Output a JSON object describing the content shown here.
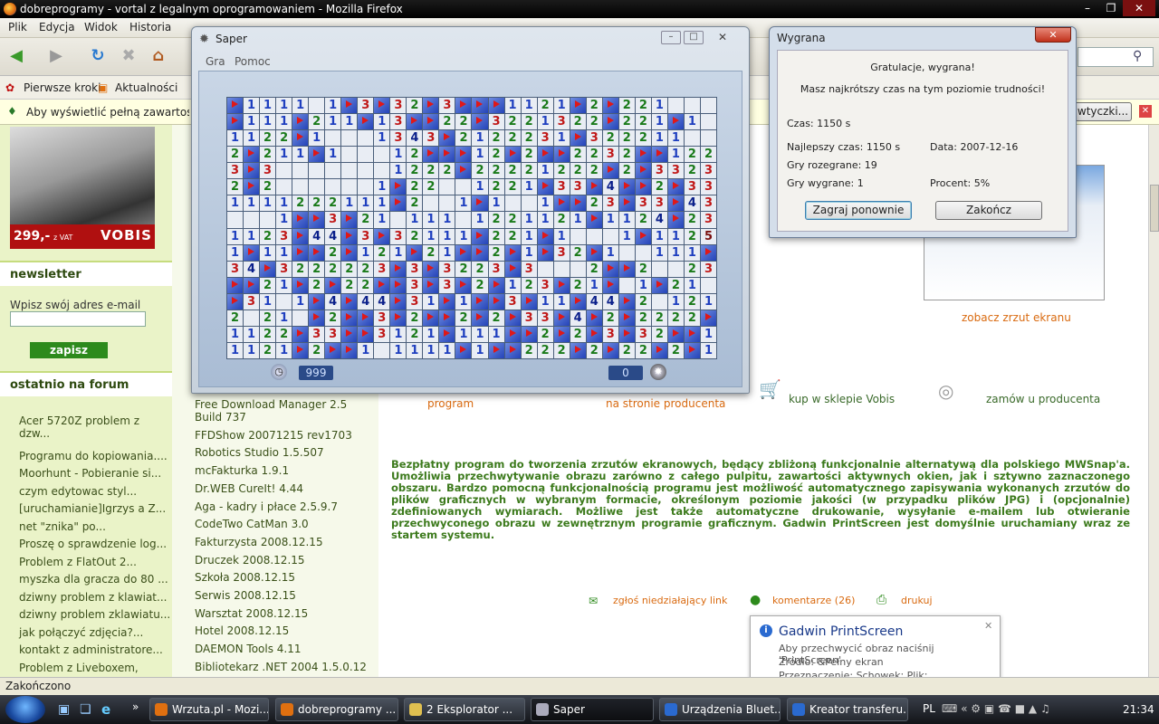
{
  "firefox": {
    "title": "dobreprogramy - vortal z legalnym oprogramowaniem - Mozilla Firefox",
    "menu": [
      "Plik",
      "Edycja",
      "Widok",
      "Historia",
      "Zakładki",
      "Narzędzia",
      "Pomoc"
    ],
    "bookmarks": [
      "Pierwsze kroki",
      "Aktualności"
    ],
    "info_bar": "Aby wyświetlić pełną zawartość tej strony, należy zainstalować dodatkowe wtyczki.",
    "info_button": "wtyczki...",
    "status": "Zakończono"
  },
  "page": {
    "ad_price": "299,-",
    "ad_vat": "z VAT",
    "ad_brand": "VOBIS",
    "newsletter_heading": "newsletter",
    "newsletter_label": "Wpisz swój adres e-mail",
    "newsletter_submit": "zapisz",
    "forum_heading": "ostatnio na forum",
    "forum_items": [
      "Acer 5720Z problem z dzw...",
      "Programu do kopiowania....",
      "Moorhunt - Pobieranie si...",
      "czym edytowac styl...",
      "[uruchamianie]Igrzys a Z...",
      "net \"znika\" po...",
      "Proszę o sprawdzenie log...",
      "Problem z FlatOut 2...",
      "myszka dla gracza do 80 ...",
      "dziwny problem z klawiat...",
      "dziwny problem zklawiatu...",
      "jak połączyć zdjęcia?...",
      "kontakt z administratore...",
      "Problem z Liveboxem,"
    ],
    "downloads": [
      "Free Download Manager 2.5 Build 737",
      "FFDShow 20071215 rev1703",
      "Robotics Studio 1.5.507",
      "mcFakturka 1.9.1",
      "Dr.WEB CureIt! 4.44",
      "Aga - kadry i płace 2.5.9.7",
      "CodeTwo CatMan 3.0",
      "Fakturzysta 2008.12.15",
      "Druczek 2008.12.15",
      "Szkoła 2008.12.15",
      "Serwis 2008.12.15",
      "Warsztat 2008.12.15",
      "Hotel 2008.12.15",
      "DAEMON Tools 4.11",
      "Bibliotekarz .NET 2004 1.5.0.12"
    ],
    "actions": {
      "download": "program",
      "producer_link": "na stronie producenta",
      "shop": "kup w sklepie Vobis",
      "order": "zamów u producenta"
    },
    "screenshot_link": "zobacz zrzut ekranu",
    "description": "Bezpłatny program do tworzenia zrzutów ekranowych, będący zbliżoną funkcjonalnie alternatywą dla polskiego MWSnap'a. Umożliwia przechwytywanie obrazu zarówno z całego pulpitu, zawartości aktywnych okien, jak i sztywno zaznaczonego obszaru. Bardzo pomocną funkcjonalnością programu jest możliwość automatycznego zapisywania wykonanych zrzutów do plików graficznych w wybranym formacie, określonym poziomie jakości (w przypadku plików JPG) i (opcjonalnie) zdefiniowanych wymiarach. Możliwe jest także automatyczne drukowanie, wysyłanie e-mailem lub otwieranie przechwyconego obrazu w zewnętrznym programie graficznym. Gadwin PrintScreen jest domyślnie uruchamiany wraz ze startem systemu.",
    "links": {
      "report": "zgłoś niedziałający link",
      "comments": "komentarze (26)",
      "print": "drukuj"
    }
  },
  "saper": {
    "title": "Saper",
    "menu": [
      "Gra",
      "Pomoc"
    ],
    "timer": "999",
    "mines_left": "0",
    "rows": [
      "F1111.1F3F32F3FFF1121F2F221....",
      "F111F211F13FF22F3221322F221F1..",
      "1122F1...1343F2122231F322211...",
      "2F211F1...12FFF12F2FF2232FF12221",
      "3F3.......1222F22221222F2F3323343F1",
      "2F2......1F22..1221F33F4FF2F33F21",
      "1111222111F2..1F1..1FF23F33F43321",
      "...1FF3F21.111.1221121F1124F23F",
      "1123F44F3F32111F221F1...1F1125F5",
      "1F11FF2F121F21FF2F1F32F1..111FF2F4F",
      "34F3222223F3F3223F3...2FF2..2332F1",
      "FF21F2F22FF3F3F2F123F21F.1F21..",
      "F31.1F4F44F31F1FF3F11F44F2.1211..",
      "2.21.F2FF3F2FF2F2F33F4F2F2222F1..",
      "1122F33FF3121F111FF2F2F3F32FF1..",
      "1121F2FF1.1111F1FF222F2F22F2F1.."
    ]
  },
  "dialog": {
    "title": "Wygrana",
    "congrats": "Gratulacje, wygrana!",
    "record": "Masz najkrótszy czas na tym poziomie trudności!",
    "time": "Czas: 1150 s",
    "best_time": "Najlepszy czas: 1150 s",
    "date": "Data: 2007-12-16",
    "played": "Gry rozegrane: 19",
    "won": "Gry wygrane: 1",
    "percent": "Procent: 5%",
    "play_again": "Zagraj ponownie",
    "close": "Zakończ"
  },
  "notification": {
    "title": "Gadwin PrintScreen",
    "line1": "Aby przechwycić obraz naciśnij 'PrintScreen'",
    "line2": "Źródło:  &Pełny ekran",
    "line3": "Przeznaczenie:  Schowek; Plik;"
  },
  "taskbar": {
    "items": [
      "Wrzuta.pl - Mozi...",
      "dobreprogramy ...",
      "2 Eksplorator ...",
      "Saper",
      "Urządzenia Bluet...",
      "Kreator transferu..."
    ],
    "lang": "PL",
    "clock": "21:34"
  }
}
